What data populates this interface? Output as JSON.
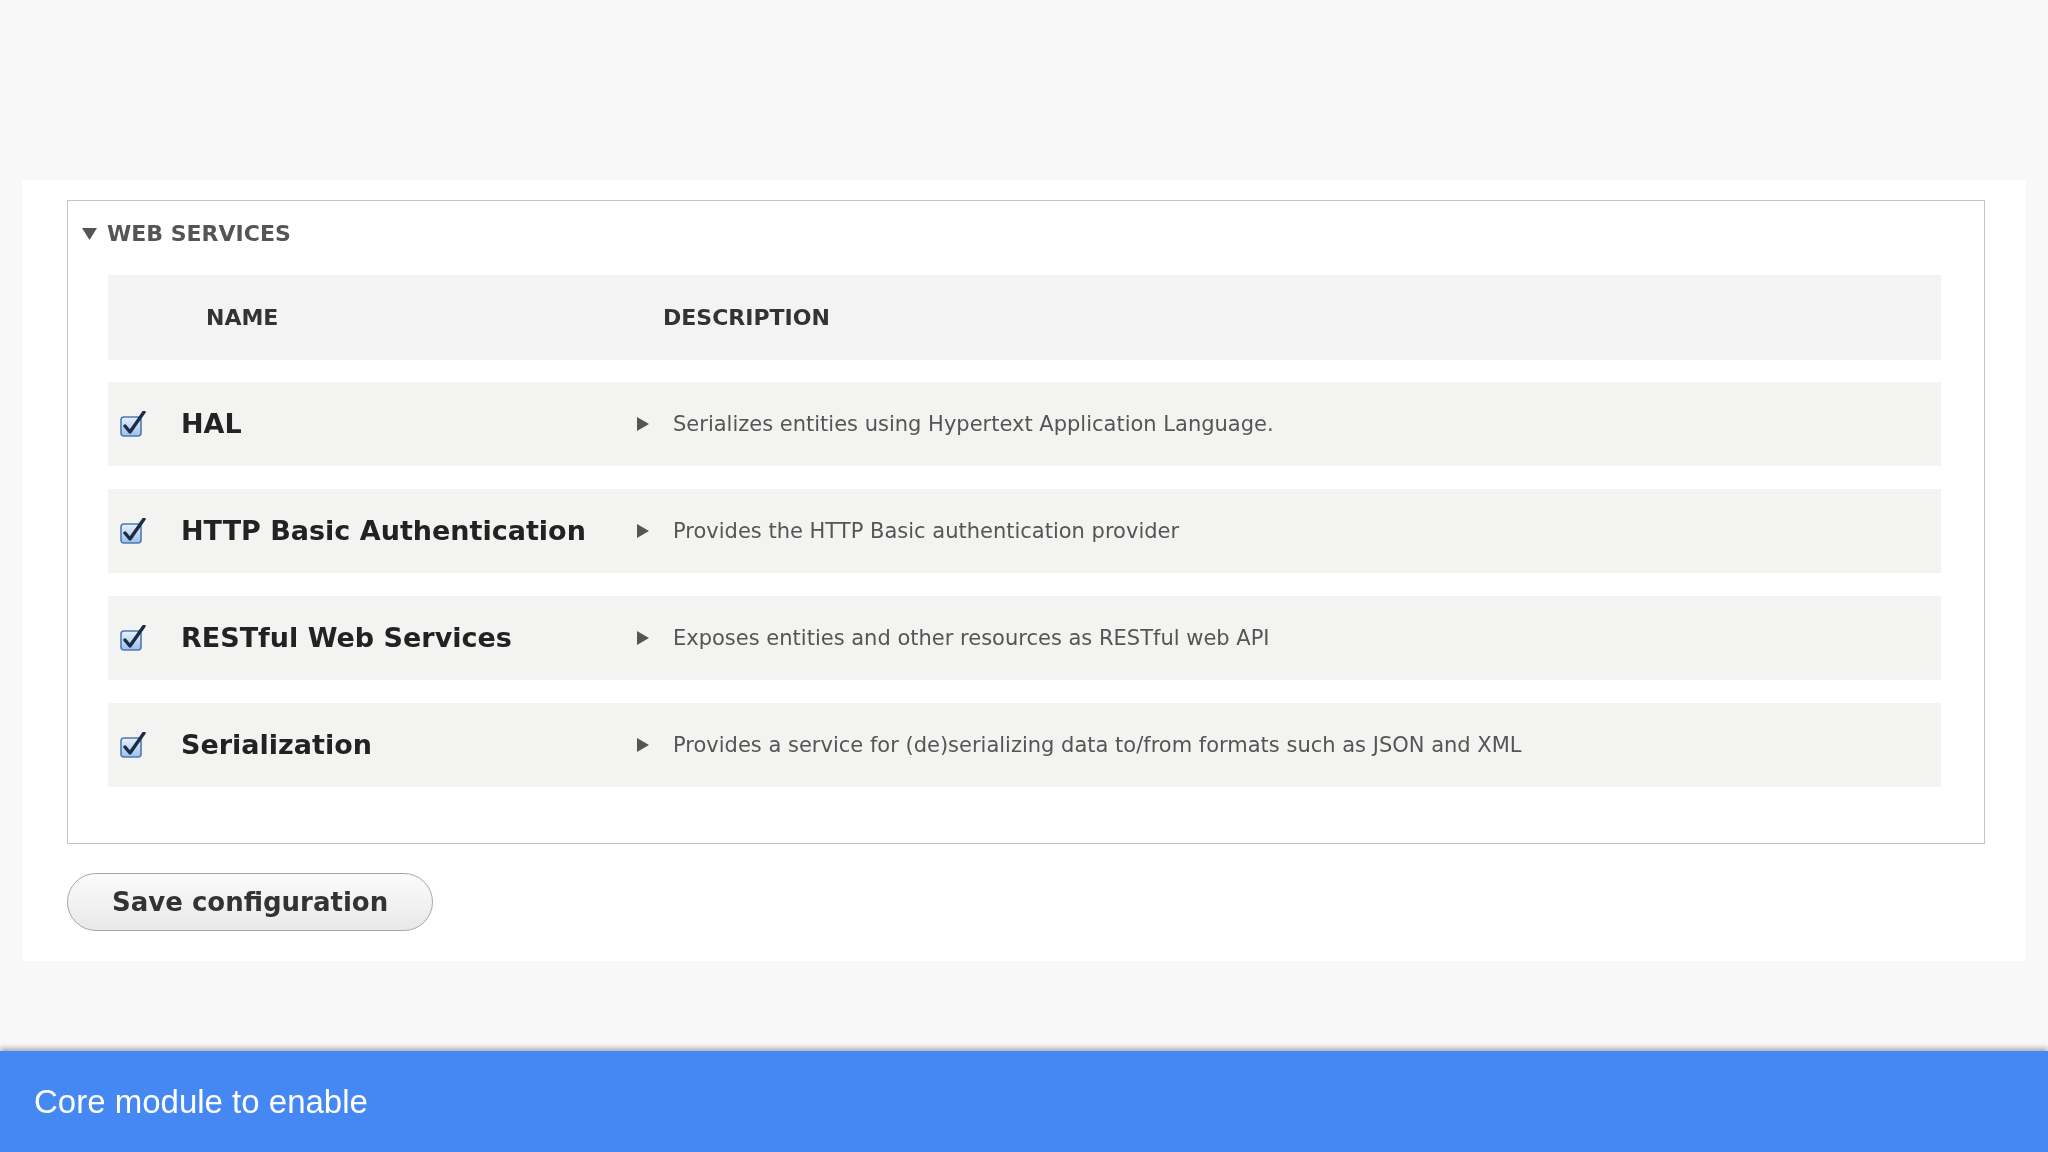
{
  "section": {
    "title": "WEB SERVICES",
    "expanded": true,
    "columns": [
      "NAME",
      "DESCRIPTION"
    ],
    "modules": [
      {
        "name": "HAL",
        "checked": true,
        "expanded": false,
        "description": "Serializes entities using Hypertext Application Language."
      },
      {
        "name": "HTTP Basic Authentication",
        "checked": true,
        "expanded": false,
        "description": "Provides the HTTP Basic authentication provider"
      },
      {
        "name": "RESTful Web Services",
        "checked": true,
        "expanded": false,
        "description": "Exposes entities and other resources as RESTful web API"
      },
      {
        "name": "Serialization",
        "checked": true,
        "expanded": false,
        "description": "Provides a service for (de)serializing data to/from formats such as JSON and XML"
      }
    ]
  },
  "buttons": [
    {
      "label": "Save configuration"
    }
  ],
  "caption": "Core module to enable"
}
